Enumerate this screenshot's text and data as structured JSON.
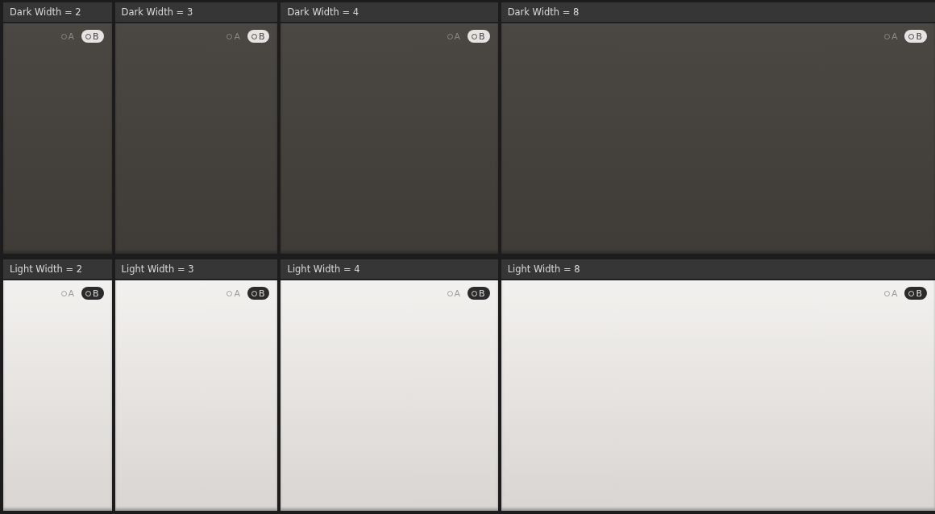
{
  "rows": [
    {
      "kind": "dark",
      "panels": [
        {
          "title": "Dark Width = 2",
          "options": [
            {
              "label": "A",
              "selected": false
            },
            {
              "label": "B",
              "selected": true
            }
          ]
        },
        {
          "title": "Dark Width = 3",
          "options": [
            {
              "label": "A",
              "selected": false
            },
            {
              "label": "B",
              "selected": true
            }
          ]
        },
        {
          "title": "Dark Width = 4",
          "options": [
            {
              "label": "A",
              "selected": false
            },
            {
              "label": "B",
              "selected": true
            }
          ]
        },
        {
          "title": "Dark Width = 8",
          "options": [
            {
              "label": "A",
              "selected": false
            },
            {
              "label": "B",
              "selected": true
            }
          ]
        }
      ]
    },
    {
      "kind": "light",
      "panels": [
        {
          "title": "Light Width = 2",
          "options": [
            {
              "label": "A",
              "selected": false
            },
            {
              "label": "B",
              "selected": true
            }
          ]
        },
        {
          "title": "Light Width = 3",
          "options": [
            {
              "label": "A",
              "selected": false
            },
            {
              "label": "B",
              "selected": true
            }
          ]
        },
        {
          "title": "Light Width = 4",
          "options": [
            {
              "label": "A",
              "selected": false
            },
            {
              "label": "B",
              "selected": true
            }
          ]
        },
        {
          "title": "Light Width = 8",
          "options": [
            {
              "label": "A",
              "selected": false
            },
            {
              "label": "B",
              "selected": true
            }
          ]
        }
      ]
    }
  ]
}
